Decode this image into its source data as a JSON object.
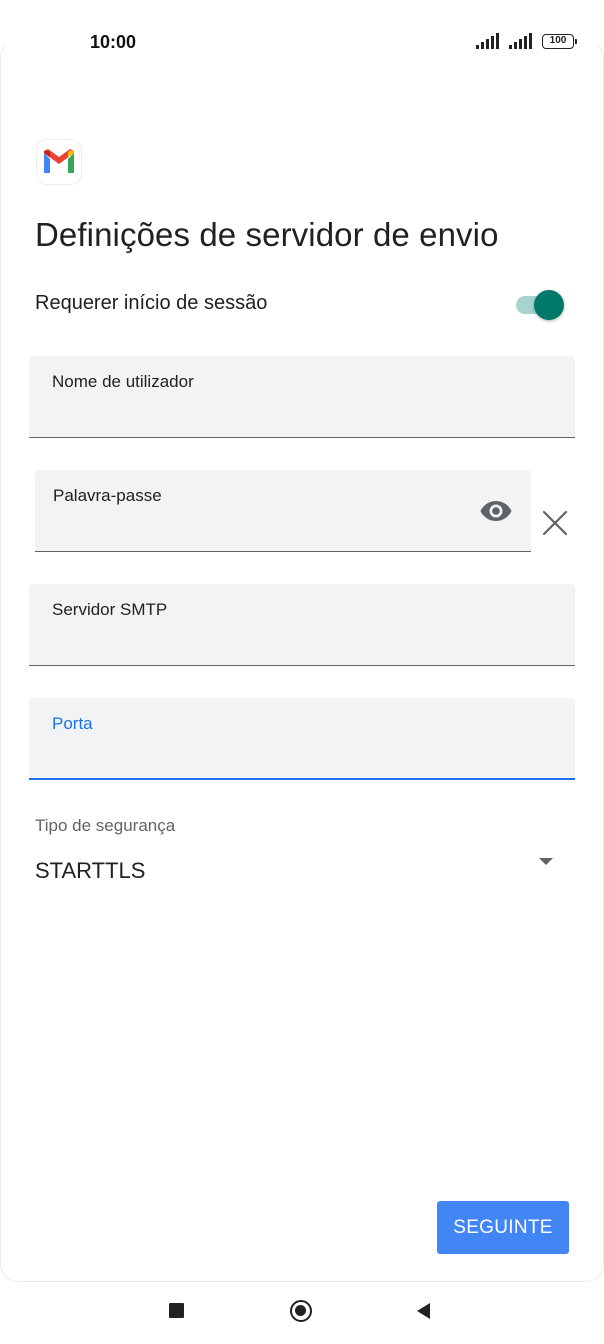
{
  "status_bar": {
    "time": "10:00",
    "battery": "100",
    "icons": [
      "signal-icon",
      "signal-icon",
      "battery-icon"
    ]
  },
  "app": {
    "logo_icon": "gmail-logo-icon"
  },
  "page": {
    "title": "Definições de servidor de envio"
  },
  "require_login": {
    "label": "Requerer início de sessão",
    "enabled": true,
    "accent_color": "#00796b"
  },
  "fields": {
    "username": {
      "label": "Nome de utilizador",
      "value": ""
    },
    "password": {
      "label": "Palavra-passe",
      "value": "",
      "show_icon": "eye-icon",
      "clear_icon": "close-icon"
    },
    "smtp_server": {
      "label": "Servidor SMTP",
      "value": ""
    },
    "port": {
      "label": "Porta",
      "value": "",
      "focused": true,
      "focus_color": "#1a73e8"
    }
  },
  "security": {
    "label": "Tipo de segurança",
    "selected": "STARTTLS"
  },
  "actions": {
    "next_label": "SEGUINTE",
    "next_color": "#4285f4"
  },
  "nav_bar": {
    "icons": [
      "recents-icon",
      "home-icon",
      "back-icon"
    ]
  }
}
